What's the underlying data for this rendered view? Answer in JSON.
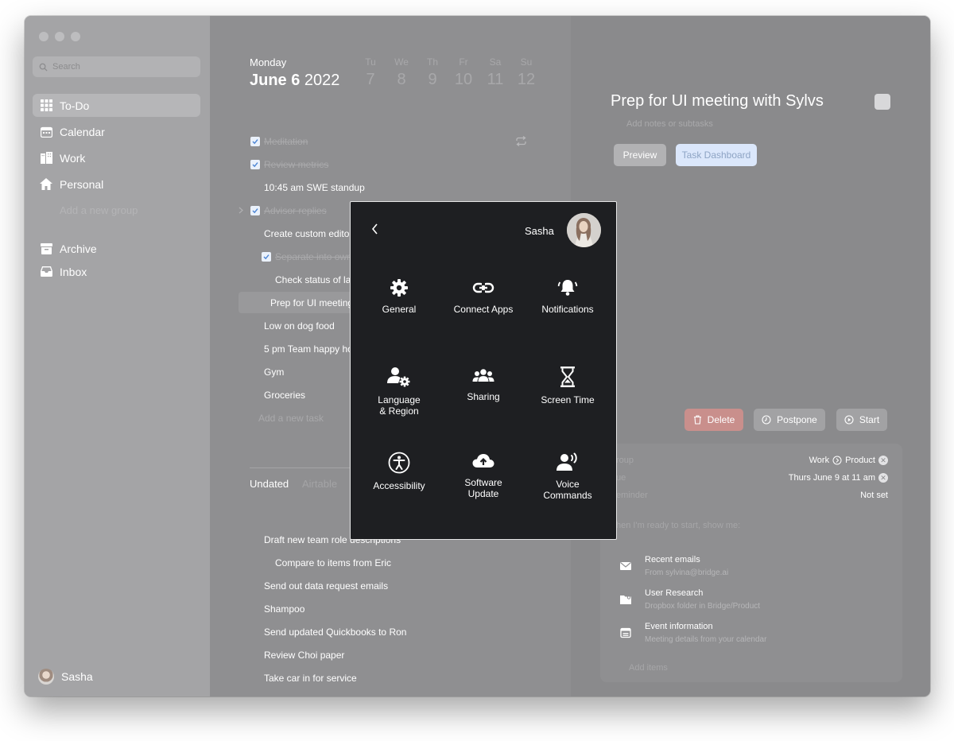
{
  "sidebar": {
    "search_placeholder": "Search",
    "items": [
      {
        "label": "To-Do",
        "icon": "grid-icon",
        "active": true
      },
      {
        "label": "Calendar",
        "icon": "calendar-icon"
      },
      {
        "label": "Work",
        "icon": "building-icon"
      },
      {
        "label": "Personal",
        "icon": "home-icon"
      }
    ],
    "add_group": "Add a new group",
    "archive": "Archive",
    "inbox": "Inbox",
    "user": "Sasha"
  },
  "day": {
    "weekday": "Monday",
    "month_day": "June 6",
    "year": "2022",
    "week": [
      {
        "d": "Tu",
        "n": "7"
      },
      {
        "d": "We",
        "n": "8"
      },
      {
        "d": "Th",
        "n": "9"
      },
      {
        "d": "Fr",
        "n": "10"
      },
      {
        "d": "Sa",
        "n": "11"
      },
      {
        "d": "Su",
        "n": "12"
      }
    ]
  },
  "tasks": {
    "meditation": "Meditation",
    "review_metrics": "Review metrics",
    "standup": "10:45 am SWE standup",
    "advisor": "Advisor replies",
    "custom_editor": "Create custom editor",
    "separate": "Separate into own",
    "check_status": "Check status of lay",
    "prep": "Prep for UI meeting",
    "dog_food": "Low on dog food",
    "happy_hour": "5 pm Team happy hou",
    "gym": "Gym",
    "groceries": "Groceries",
    "add_task": "Add a new task"
  },
  "tabs": {
    "undated": "Undated",
    "airtable": "Airtable"
  },
  "undated": {
    "draft": "Draft new team role descriptions",
    "compare": "Compare to items from Eric",
    "send_data": "Send out data request emails",
    "shampoo": "Shampoo",
    "quickbooks": "Send updated Quickbooks to Ron",
    "choi": "Review Choi paper",
    "car": "Take car in for service"
  },
  "detail": {
    "title": "Prep for UI meeting with Sylvs",
    "notes": "Add notes or subtasks",
    "preview": "Preview",
    "dashboard": "Task Dashboard",
    "delete": "Delete",
    "postpone": "Postpone",
    "start": "Start",
    "group_label": "roup",
    "group_value_1": "Work",
    "group_value_2": "Product",
    "due_label": "ue",
    "due_value": "Thurs June 9 at 11 am",
    "reminder_label": "eminder",
    "reminder_value": "Not set",
    "ready": "hen I'm ready to start, show me:",
    "resources": [
      {
        "title": "Recent emails",
        "sub": "From sylvina@bridge.ai",
        "icon": "mail-icon"
      },
      {
        "title": "User Research",
        "sub": "Dropbox folder in Bridge/Product",
        "icon": "folder-icon"
      },
      {
        "title": "Event information",
        "sub": "Meeting details from your calendar",
        "icon": "calendar-icon"
      }
    ],
    "add_items": "Add items"
  },
  "modal": {
    "user": "Sasha",
    "items": [
      {
        "label": "General",
        "icon": "gear-icon"
      },
      {
        "label": "Connect Apps",
        "icon": "link-icon"
      },
      {
        "label": "Notifications",
        "icon": "bell-icon"
      },
      {
        "label": "Language",
        "label2": "& Region",
        "icon": "user-gear-icon"
      },
      {
        "label": "Sharing",
        "icon": "users-icon"
      },
      {
        "label": "Screen Time",
        "icon": "hourglass-icon"
      },
      {
        "label": "Accessibility",
        "icon": "accessibility-icon"
      },
      {
        "label": "Software",
        "label2": "Update",
        "icon": "cloud-upload-icon"
      },
      {
        "label": "Voice",
        "label2": "Commands",
        "icon": "voice-icon"
      }
    ]
  },
  "colors": {
    "modal_bg": "#1e1f22",
    "dashboard_btn": "#dbe7fb",
    "delete_btn": "#c98f8c",
    "check": "#eaf1fb"
  }
}
